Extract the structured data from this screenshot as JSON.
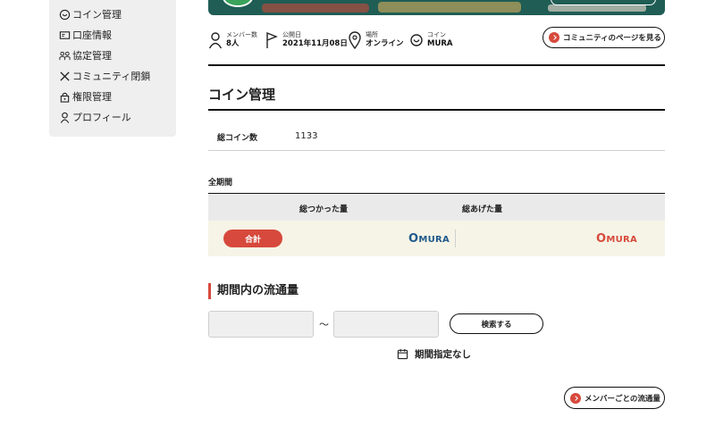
{
  "sidebar": {
    "items": [
      {
        "label": "コイン管理",
        "icon": "coin-icon"
      },
      {
        "label": "口座情報",
        "icon": "account-card-icon"
      },
      {
        "label": "協定管理",
        "icon": "agreement-icon"
      },
      {
        "label": "コミュニティ閉鎖",
        "icon": "close-icon"
      },
      {
        "label": "権限管理",
        "icon": "lock-icon"
      },
      {
        "label": "プロフィール",
        "icon": "person-icon"
      }
    ]
  },
  "community": {
    "members_label": "メンバー数",
    "members_value": "8人",
    "published_label": "公開日",
    "published_value": "2021年11月08日",
    "place_label": "場所",
    "place_value": "オンライン",
    "coin_label": "コイン",
    "coin_value": "MURA",
    "view_page_button": "コミュニティのページを見る"
  },
  "coin_management": {
    "title": "コイン管理",
    "total_label": "総コイン数",
    "total_value": "1133",
    "period_label": "全期間",
    "col_used": "総つかった量",
    "col_given": "総あげた量",
    "sum_badge": "合計",
    "used_logo_initial": "O",
    "used_logo_rest": "MURA",
    "given_logo_initial": "O",
    "given_logo_rest": "MURA"
  },
  "flow": {
    "title": "期間内の流通量",
    "tilde": "～",
    "search_button": "検索する",
    "no_period": "期間指定なし",
    "member_flow_button": "メンバーごとの流通量"
  },
  "colors": {
    "accent_red": "#d6493c",
    "coin_blue": "#1f5a8c",
    "coin_red": "#d6493c"
  }
}
